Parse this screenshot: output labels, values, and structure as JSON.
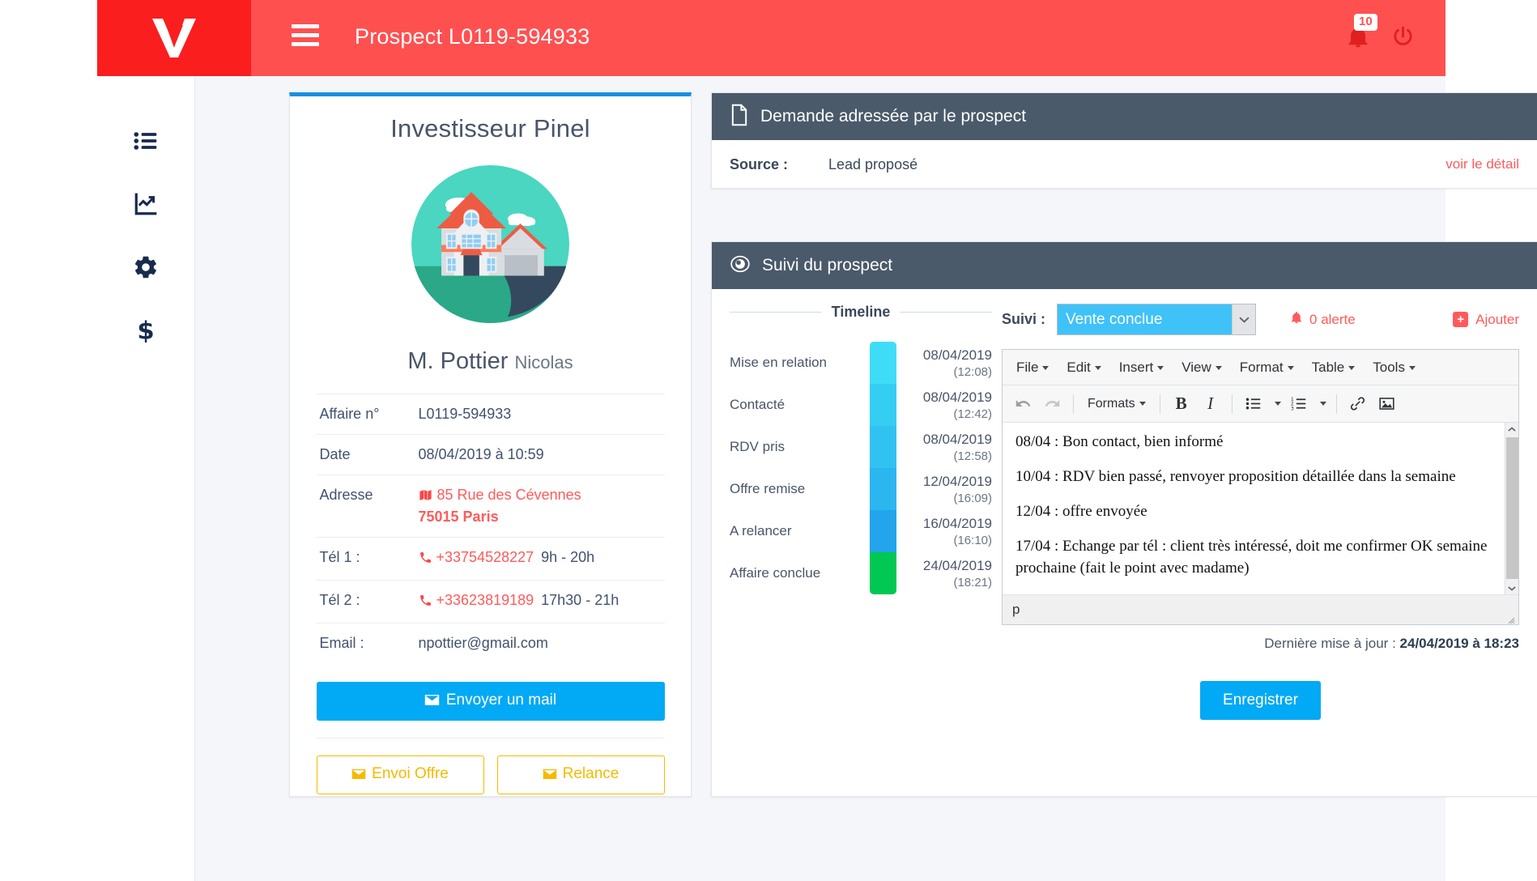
{
  "topbar": {
    "logo_name": "vivaneo-logo",
    "title": "Prospect L0119-594933",
    "notification_count": "10",
    "bell_icon": "bell-icon",
    "power_icon": "power-icon",
    "menu_icon": "hamburger-icon"
  },
  "sidebar": {
    "items": [
      {
        "name": "sidebar-item-list",
        "icon": "list-ul-icon"
      },
      {
        "name": "sidebar-item-stats",
        "icon": "chart-line-icon"
      },
      {
        "name": "sidebar-item-settings",
        "icon": "gear-icon"
      },
      {
        "name": "sidebar-item-billing",
        "icon": "dollar-icon"
      }
    ]
  },
  "profile": {
    "title": "Investisseur Pinel",
    "avatar_icon": "house-illustration",
    "lastname": "M. Pottier",
    "firstname": "Nicolas",
    "rows": [
      {
        "label": "Affaire n°",
        "value": "L0119-594933"
      },
      {
        "label": "Date",
        "value": "08/04/2019 à 10:59"
      }
    ],
    "address": {
      "label": "Adresse",
      "icon": "map-icon",
      "line1": "85 Rue des Cévennes",
      "line2": "75015 Paris"
    },
    "phones": [
      {
        "label": "Tél 1 :",
        "icon": "phone-icon",
        "number": "+33754528227",
        "hours": "9h - 20h"
      },
      {
        "label": "Tél 2 :",
        "icon": "phone-icon",
        "number": "+33623819189",
        "hours": "17h30 - 21h"
      }
    ],
    "email": {
      "label": "Email :",
      "value": "npottier@gmail.com"
    },
    "buttons": {
      "mail": "Envoyer un mail",
      "offre": "Envoi Offre",
      "relance": "Relance",
      "mail_icon": "envelope-icon"
    }
  },
  "demande": {
    "header": "Demande adressée par le prospect",
    "header_icon": "file-icon",
    "source_label": "Source :",
    "source_value": "Lead proposé",
    "detail_link": "voir le détail"
  },
  "suivi": {
    "header": "Suivi du prospect",
    "header_icon": "eye-icon",
    "timeline_title": "Timeline",
    "timeline": [
      {
        "label": "Mise en relation",
        "date": "08/04/2019",
        "time": "(12:08)",
        "color": "#3fdcf7"
      },
      {
        "label": "Contacté",
        "date": "08/04/2019",
        "time": "(12:42)",
        "color": "#35cdf2"
      },
      {
        "label": "RDV pris",
        "date": "08/04/2019",
        "time": "(12:58)",
        "color": "#31c2f1"
      },
      {
        "label": "Offre remise",
        "date": "12/04/2019",
        "time": "(16:09)",
        "color": "#2bb6ef"
      },
      {
        "label": "A relancer",
        "date": "16/04/2019",
        "time": "(16:10)",
        "color": "#23a4ec"
      },
      {
        "label": "Affaire conclue",
        "date": "24/04/2019",
        "time": "(18:21)",
        "color": "#00c853"
      }
    ],
    "suivi_label": "Suivi :",
    "suivi_selected": "Vente conclue",
    "alert_text": "0 alerte",
    "alert_icon": "bell-icon",
    "add_text": "Ajouter",
    "add_icon": "plus-square-icon",
    "last_update_label": "Dernière mise à jour :",
    "last_update_value": "24/04/2019 à 18:23",
    "save_button": "Enregistrer"
  },
  "editor": {
    "menus": [
      "File",
      "Edit",
      "Insert",
      "View",
      "Format",
      "Table",
      "Tools"
    ],
    "toolbar": {
      "undo_icon": "undo-icon",
      "redo_icon": "redo-icon",
      "formats_label": "Formats",
      "bold_label": "B",
      "italic_label": "I",
      "bullist_icon": "bullet-list-icon",
      "numlist_icon": "numbered-list-icon",
      "link_icon": "link-icon",
      "image_icon": "image-icon"
    },
    "body": [
      "08/04 : Bon contact, bien informé",
      "10/04 : RDV bien passé, renvoyer proposition détaillée dans la semaine",
      "12/04 : offre envoyée",
      "17/04 : Echange par tél : client très intéressé, doit me confirmer OK semaine prochaine (fait le point avec madame)"
    ],
    "statusbar_path": "p"
  },
  "colors": {
    "brand_red": "#ff5050",
    "logo_red": "#fa1e1e",
    "panel_header": "#4a5a6a",
    "accent_blue": "#02a9f4",
    "card_top_border": "#1a8fe0",
    "warning_yellow": "#f5ba00",
    "link_red": "#ff5b5b"
  }
}
